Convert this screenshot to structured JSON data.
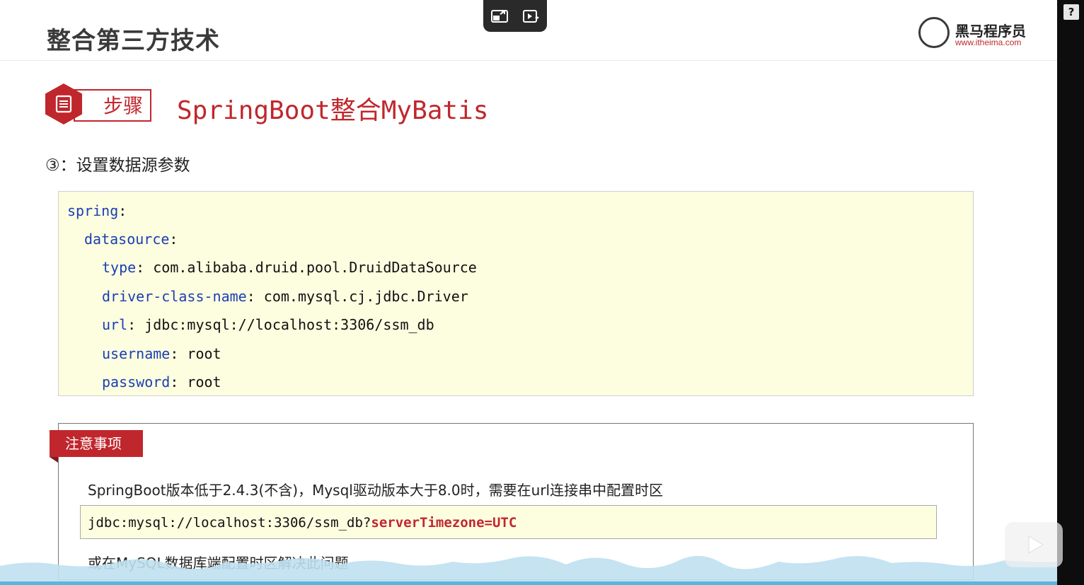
{
  "slide": {
    "title": "整合第三方技术",
    "logo": {
      "name": "黑马程序员",
      "url": "www.itheima.com"
    },
    "step": {
      "label": "步骤",
      "title": "SpringBoot整合MyBatis"
    },
    "subtitle": "③：设置数据源参数",
    "code": {
      "lines": [
        {
          "key": "spring",
          "sep": ":",
          "value": ""
        },
        {
          "key": "datasource",
          "sep": ":",
          "value": ""
        },
        {
          "key": "type",
          "sep": ":",
          "value": " com.alibaba.druid.pool.DruidDataSource"
        },
        {
          "key": "driver-class-name",
          "sep": ":",
          "value": " com.mysql.cj.jdbc.Driver"
        },
        {
          "key": "url",
          "sep": ":",
          "value": " jdbc:mysql://localhost:3306/ssm_db"
        },
        {
          "key": "username",
          "sep": ":",
          "value": " root"
        },
        {
          "key": "password",
          "sep": ":",
          "value": " root"
        }
      ]
    },
    "note": {
      "tab": "注意事项",
      "text": "SpringBoot版本低于2.4.3(不含)，Mysql驱动版本大于8.0时，需要在url连接串中配置时区",
      "code_prefix": "jdbc:mysql://localhost:3306/ssm_db?",
      "code_highlight": "serverTimezone=UTC",
      "text2": "或在MySQL数据库端配置时区解决此问题"
    }
  },
  "player": {
    "help_label": "?",
    "controls": [
      "exit-fullscreen-icon",
      "video-effects-icon",
      "play-icon"
    ]
  },
  "colors": {
    "accent": "#c0272d",
    "key": "#1a3fb3",
    "code_bg": "#fdfde0"
  }
}
